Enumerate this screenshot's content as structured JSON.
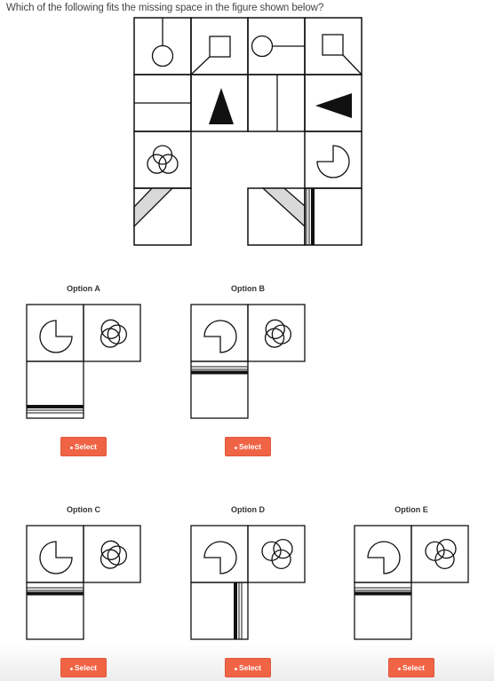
{
  "question": "Which of the following fits the missing space in the figure shown below?",
  "puzzle": {
    "rows": 4,
    "columns": 4,
    "cells": [
      {
        "row": 0,
        "col": 0,
        "figure": "circle-hanging-from-top"
      },
      {
        "row": 0,
        "col": 1,
        "figure": "square-with-diagonal-to-bottom-left"
      },
      {
        "row": 0,
        "col": 2,
        "figure": "circle-with-line-to-right"
      },
      {
        "row": 0,
        "col": 3,
        "figure": "square-with-diagonal-to-bottom-right"
      },
      {
        "row": 1,
        "col": 0,
        "figure": "horizontal-line"
      },
      {
        "row": 1,
        "col": 1,
        "figure": "black-triangle-up"
      },
      {
        "row": 1,
        "col": 2,
        "figure": "vertical-line"
      },
      {
        "row": 1,
        "col": 3,
        "figure": "black-triangle-left"
      },
      {
        "row": 2,
        "col": 0,
        "figure": "three-circles-triangle"
      },
      {
        "row": 2,
        "col": 1,
        "figure": "missing"
      },
      {
        "row": 2,
        "col": 2,
        "figure": "missing"
      },
      {
        "row": 2,
        "col": 3,
        "figure": "pacman-circle-topleft-cut"
      },
      {
        "row": 3,
        "col": 0,
        "figure": "gray-diagonal-band-top-right"
      },
      {
        "row": 3,
        "col": 1,
        "figure": "missing"
      },
      {
        "row": 3,
        "col": 2,
        "figure": "gray-diagonal-band-top-left"
      },
      {
        "row": 3,
        "col": 3,
        "figure": "vertical-stripes-left"
      }
    ]
  },
  "options": [
    {
      "id": "A",
      "label": "Option A",
      "button": "Select",
      "pie": "cut-top-right",
      "circles": "triangle-up",
      "stripes": "horizontal-bottom"
    },
    {
      "id": "B",
      "label": "Option B",
      "button": "Select",
      "pie": "cut-bottom-left",
      "circles": "triangle-up",
      "stripes": "horizontal-top"
    },
    {
      "id": "C",
      "label": "Option C",
      "button": "Select",
      "pie": "cut-top-right",
      "circles": "triangle-up",
      "stripes": "horizontal-top"
    },
    {
      "id": "D",
      "label": "Option D",
      "button": "Select",
      "pie": "cut-bottom-left",
      "circles": "triangle-down",
      "stripes": "vertical-right"
    },
    {
      "id": "E",
      "label": "Option E",
      "button": "Select",
      "pie": "cut-bottom-left",
      "circles": "triangle-down",
      "stripes": "horizontal-top"
    }
  ],
  "colors": {
    "button": "#f06446",
    "band_fill": "#d9d9d9",
    "ink": "#111111"
  }
}
